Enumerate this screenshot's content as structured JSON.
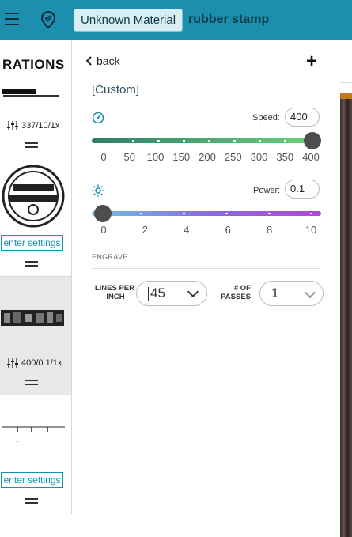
{
  "topbar": {
    "material_button": "Unknown Material",
    "job_title": "rubber stamp"
  },
  "sidebar": {
    "cards": [
      {
        "thumb_text": "RATIONS",
        "settings": "337/10/1x"
      },
      {
        "thumb_text": "",
        "button": "enter settings"
      },
      {
        "thumb_text": "",
        "settings": "400/0.1/1x"
      },
      {
        "thumb_text": "",
        "button": "enter settings"
      }
    ]
  },
  "panel": {
    "back_label": "back",
    "add_label": "+",
    "preset_name": "[Custom]",
    "speed": {
      "label": "Speed:",
      "value": "400",
      "ticks": [
        "0",
        "50",
        "100",
        "150",
        "200",
        "250",
        "300",
        "350",
        "400"
      ],
      "level": 1.0
    },
    "power": {
      "label": "Power:",
      "value": "0.1",
      "ticks": [
        "0",
        "2",
        "4",
        "6",
        "8",
        "10"
      ],
      "level": 0.01
    },
    "section_title": "ENGRAVE",
    "lpi": {
      "label_line1": "LINES PER",
      "label_line2": "INCH",
      "value": "45"
    },
    "passes": {
      "label_line1": "# OF",
      "label_line2": "PASSES",
      "value": "1"
    }
  },
  "colors": {
    "accent": "#1d8fae",
    "speed_gradient_start": "#2e7d6a",
    "speed_gradient_end": "#6dd47a",
    "power_gradient_start": "#6ec3e6",
    "power_gradient_end": "#b546d8"
  }
}
